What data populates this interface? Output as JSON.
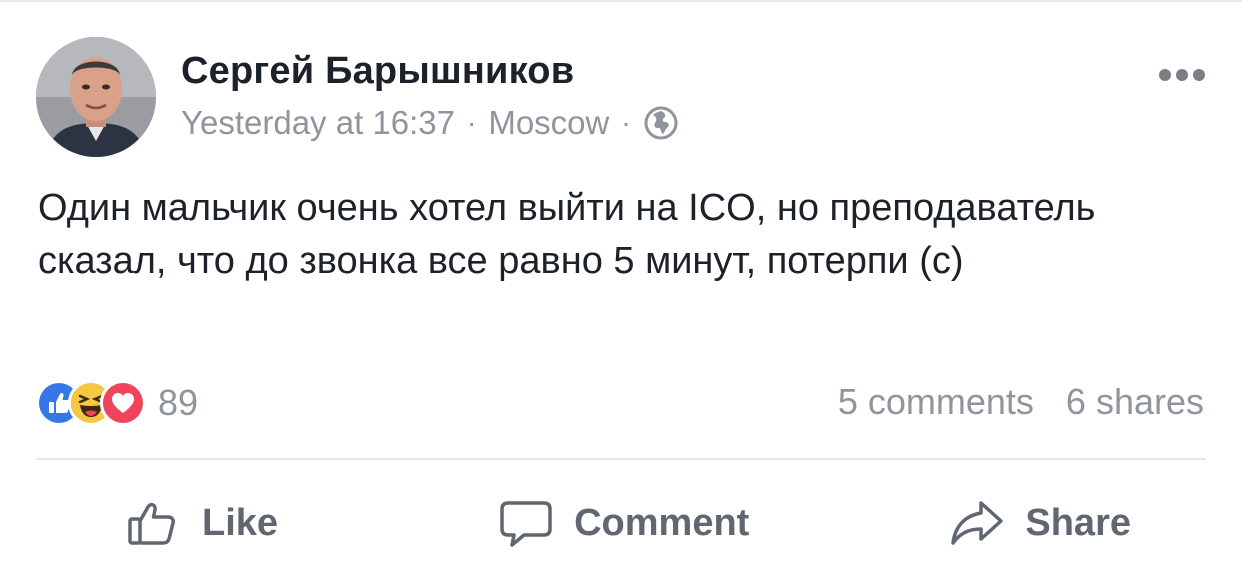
{
  "post": {
    "author": "Сергей Барышников",
    "timestamp": "Yesterday at 16:37",
    "location": "Moscow",
    "separator": "·",
    "privacy_icon": "globe-icon",
    "text": "Один мальчик очень хотел выйти на ICO, но преподаватель сказал, что до звонка все равно 5 минут, потерпи (с)"
  },
  "reactions": {
    "icons": [
      "like-reaction-icon",
      "haha-reaction-icon",
      "love-reaction-icon"
    ],
    "count": "89"
  },
  "engagement": {
    "comments": "5 comments",
    "shares": "6 shares"
  },
  "actions": {
    "like": "Like",
    "comment": "Comment",
    "share": "Share"
  },
  "colors": {
    "like_blue": "#3578e5",
    "haha_yellow": "#f7c645",
    "love_red": "#f0445d",
    "meta_gray": "#90949c",
    "action_gray": "#606770"
  }
}
